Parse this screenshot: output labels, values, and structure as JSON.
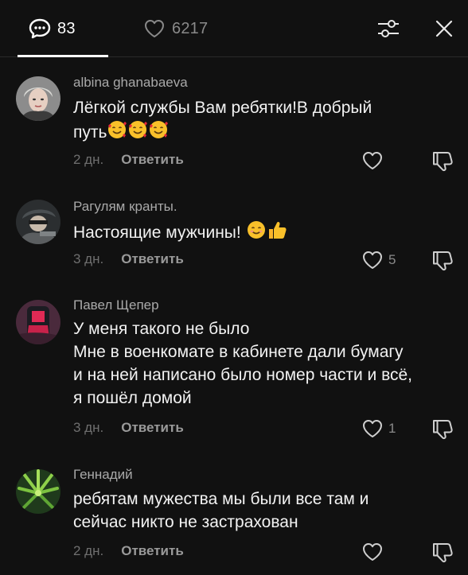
{
  "tabs": {
    "comments": {
      "icon": "comment-bubble-icon",
      "count": "83"
    },
    "likes": {
      "icon": "heart-outline-icon",
      "count": "6217"
    }
  },
  "header_icons": {
    "filter": "filter-sliders-icon",
    "close": "close-icon"
  },
  "comments": [
    {
      "author": "albina ghanabaeva",
      "text_line1": "Лёгкой службы Вам ребятки!В добрый",
      "text_line2": "путь",
      "emojis": [
        "smiling-face-with-hearts",
        "smiling-face-with-hearts",
        "smiling-face-with-hearts"
      ],
      "date": "2 дн.",
      "reply_label": "Ответить",
      "likes": ""
    },
    {
      "author": "Рагулям кранты.",
      "text": "Настоящие мужчины!",
      "emojis": [
        "smiling-face",
        "thumbs-up"
      ],
      "date": "3 дн.",
      "reply_label": "Ответить",
      "likes": "5"
    },
    {
      "author": "Павел Щепер",
      "lines": [
        "У меня такого не было",
        "Мне в военкомате в кабинете дали бумагу",
        "и на ней написано было номер части и всё,",
        "я пошёл домой"
      ],
      "date": "3 дн.",
      "reply_label": "Ответить",
      "likes": "1"
    },
    {
      "author": "Геннадий",
      "lines": [
        "ребятам мужества мы были все там и",
        "сейчас никто не застрахован"
      ],
      "date": "2 дн.",
      "reply_label": "Ответить",
      "likes": ""
    }
  ],
  "colors": {
    "background": "#111111",
    "text_primary": "#f2f2f2",
    "text_secondary": "#a9a9a9",
    "text_muted": "#6f6f6f"
  }
}
